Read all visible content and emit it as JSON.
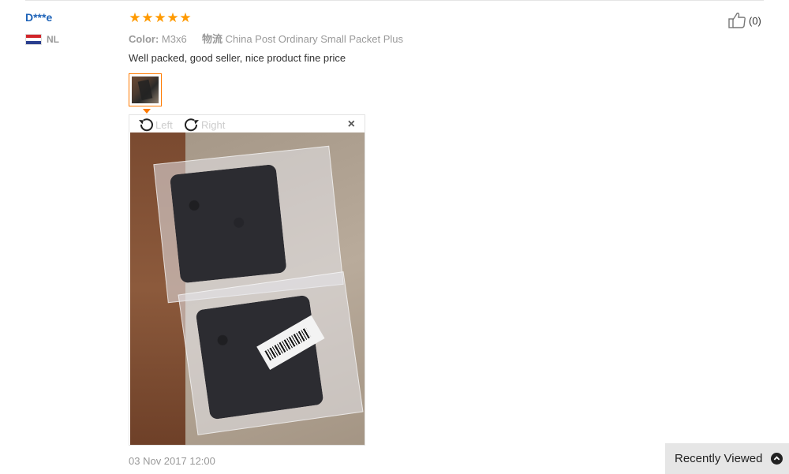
{
  "reviewer": {
    "name": "D***e",
    "country_code": "NL"
  },
  "rating": {
    "stars": 5,
    "max": 5
  },
  "attributes": {
    "color_key": "Color:",
    "color_value": "M3x6",
    "logistics_key": "物流",
    "logistics_value": "China Post Ordinary Small Packet Plus"
  },
  "review": {
    "text": "Well packed, good seller, nice product fine price",
    "date": "03 Nov 2017 12:00"
  },
  "image_viewer": {
    "rotate_left_label": "Left",
    "rotate_right_label": "Right",
    "close_label": "×"
  },
  "likes": {
    "count_text": "(0)"
  },
  "recently_viewed": {
    "label": "Recently Viewed"
  },
  "colors": {
    "star": "#ff9a00",
    "reviewer_name": "#1e63b8",
    "thumb_border": "#ff7a00"
  },
  "icons": [
    "star-icon",
    "flag-nl-icon",
    "rotate-left-icon",
    "rotate-right-icon",
    "close-icon",
    "thumbs-up-icon",
    "chevron-up-icon"
  ]
}
